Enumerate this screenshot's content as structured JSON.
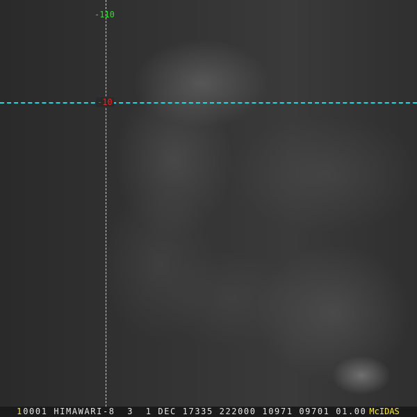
{
  "grid": {
    "lon_label": "-110",
    "lat_label": "-10"
  },
  "status_bar": {
    "frame": "1",
    "info": "0001 HIMAWARI-8  3  1 DEC 17335 222000 10971 09701 01.00",
    "brand": "McIDAS"
  },
  "colors": {
    "lat_line": "#22d8e0",
    "lon_label": "#33dd33",
    "lat_label": "#ee2222",
    "brand": "#ffee22"
  }
}
